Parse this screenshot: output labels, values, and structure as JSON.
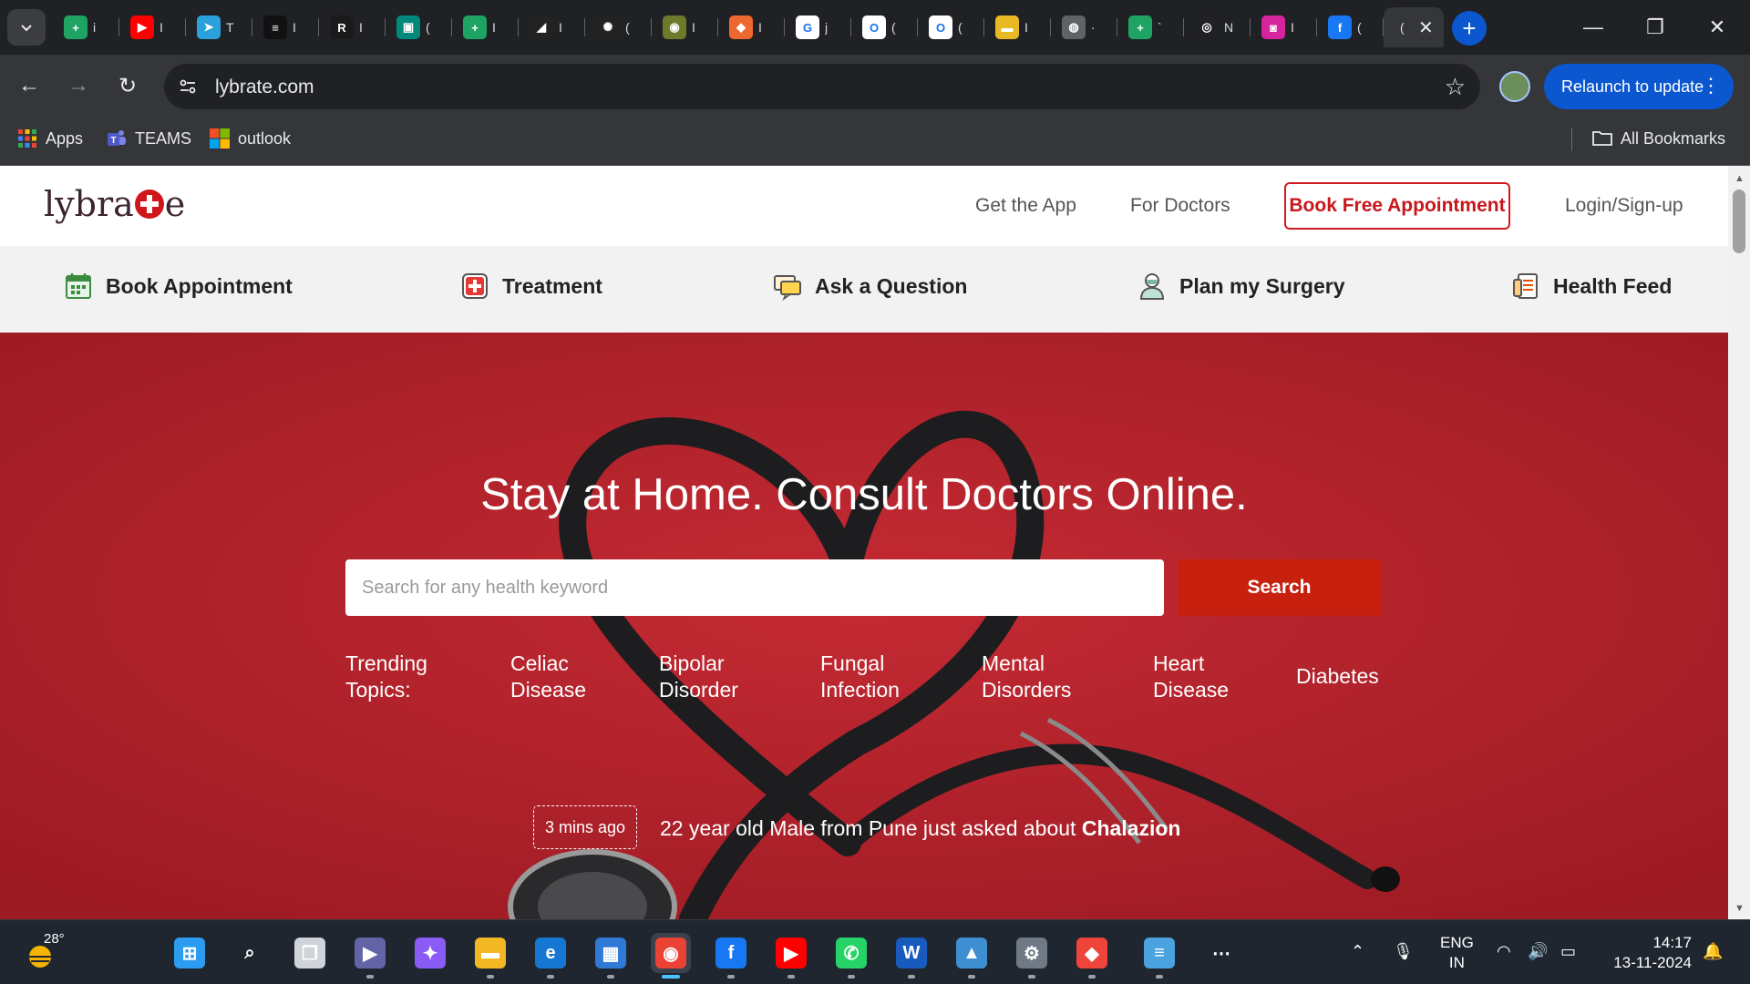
{
  "browser": {
    "tabs": [
      {
        "icon": "google-sheets-icon",
        "title": "i",
        "color": "#1ea362",
        "glyph": "+"
      },
      {
        "icon": "youtube-icon",
        "title": "I",
        "color": "#ff0000",
        "glyph": "▶"
      },
      {
        "icon": "telegram-icon",
        "title": "T",
        "color": "#2aa1da",
        "glyph": "➤"
      },
      {
        "icon": "dark-site-icon",
        "title": "I",
        "color": "#111111",
        "glyph": "≡"
      },
      {
        "icon": "hr-site-icon",
        "title": "I",
        "color": "#1a1a1a",
        "glyph": "R"
      },
      {
        "icon": "google-meet-icon",
        "title": "(",
        "color": "#00897b",
        "glyph": "▣"
      },
      {
        "icon": "google-sheets-icon",
        "title": "I",
        "color": "#1ea362",
        "glyph": "+"
      },
      {
        "icon": "chart-site-icon",
        "title": "I",
        "color": "#222222",
        "glyph": "◢"
      },
      {
        "icon": "chatgpt-icon",
        "title": "(",
        "color": "#222222",
        "glyph": "✺"
      },
      {
        "icon": "emblem-site-icon",
        "title": "I",
        "color": "#6d7a2a",
        "glyph": "◉"
      },
      {
        "icon": "magento-icon",
        "title": "I",
        "color": "#ee672f",
        "glyph": "◆"
      },
      {
        "icon": "google-icon",
        "title": "j",
        "color": "#ffffff",
        "glyph": "G"
      },
      {
        "icon": "ovi-icon",
        "title": "(",
        "color": "#ffffff",
        "glyph": "O"
      },
      {
        "icon": "ovi-icon",
        "title": "(",
        "color": "#ffffff",
        "glyph": "O"
      },
      {
        "icon": "folder-site-icon",
        "title": "I",
        "color": "#e8b923",
        "glyph": "▬"
      },
      {
        "icon": "globe-icon",
        "title": "·",
        "color": "#5f6368",
        "glyph": "◍"
      },
      {
        "icon": "google-sheets-icon",
        "title": "`",
        "color": "#1ea362",
        "glyph": "+"
      },
      {
        "icon": "record-icon",
        "title": "N",
        "color": "#202124",
        "glyph": "◎"
      },
      {
        "icon": "instagram-icon",
        "title": "I",
        "color": "#d6249f",
        "glyph": "◙"
      },
      {
        "icon": "facebook-icon",
        "title": "(",
        "color": "#1877f2",
        "glyph": "f"
      }
    ],
    "active_tab_title": "(",
    "active_tab_close": "✕",
    "new_tab_label": "+",
    "url": "lybrate.com",
    "relaunch_label": "Relaunch to update",
    "bookmarks": [
      {
        "label": "Apps",
        "icon": "apps-grid-icon"
      },
      {
        "label": "TEAMS",
        "icon": "teams-icon"
      },
      {
        "label": "outlook",
        "icon": "microsoft-icon"
      }
    ],
    "all_bookmarks_label": "All Bookmarks"
  },
  "site": {
    "logo_left": "lybra",
    "logo_right": "e",
    "header_links": {
      "get_app": "Get the App",
      "for_doctors": "For Doctors",
      "book_free": "Book Free Appointment",
      "login": "Login/Sign-up"
    },
    "categories": [
      {
        "label": "Book Appointment",
        "icon": "calendar-icon"
      },
      {
        "label": "Treatment",
        "icon": "medical-cross-icon"
      },
      {
        "label": "Ask a Question",
        "icon": "chat-bubble-icon"
      },
      {
        "label": "Plan my Surgery",
        "icon": "surgeon-icon"
      },
      {
        "label": "Health Feed",
        "icon": "document-list-icon"
      }
    ],
    "hero": {
      "title": "Stay at Home. Consult Doctors Online.",
      "search_placeholder": "Search for any health keyword",
      "search_button": "Search",
      "trending_label_1": "Trending",
      "trending_label_2": "Topics:",
      "topics": [
        {
          "line1": "Celiac",
          "line2": "Disease"
        },
        {
          "line1": "Bipolar",
          "line2": "Disorder"
        },
        {
          "line1": "Fungal",
          "line2": "Infection"
        },
        {
          "line1": "Mental",
          "line2": "Disorders"
        },
        {
          "line1": "Heart",
          "line2": "Disease"
        },
        {
          "line1": "Diabetes",
          "line2": ""
        }
      ],
      "ticker_time": "3 mins ago",
      "ticker_text": "22 year old Male from Pune just asked about ",
      "ticker_topic": "Chalazion"
    },
    "colors": {
      "brand_red": "#c7200f",
      "hero_red": "#b0202a"
    }
  },
  "taskbar": {
    "temperature": "28°",
    "apps": [
      {
        "icon": "windows-start-icon"
      },
      {
        "icon": "search-icon"
      },
      {
        "icon": "task-view-icon"
      },
      {
        "icon": "video-call-icon"
      },
      {
        "icon": "copilot-icon"
      },
      {
        "icon": "file-explorer-icon"
      },
      {
        "icon": "edge-icon"
      },
      {
        "icon": "microsoft-store-icon"
      },
      {
        "icon": "chrome-icon"
      },
      {
        "icon": "facebook-icon"
      },
      {
        "icon": "youtube-icon"
      },
      {
        "icon": "whatsapp-icon"
      },
      {
        "icon": "word-icon"
      },
      {
        "icon": "photos-icon"
      },
      {
        "icon": "settings-icon"
      },
      {
        "icon": "anydesk-icon"
      },
      {
        "icon": "notepad-icon"
      },
      {
        "icon": "more-icon"
      }
    ],
    "lang_1": "ENG",
    "lang_2": "IN",
    "time": "14:17",
    "date": "13-11-2024"
  }
}
